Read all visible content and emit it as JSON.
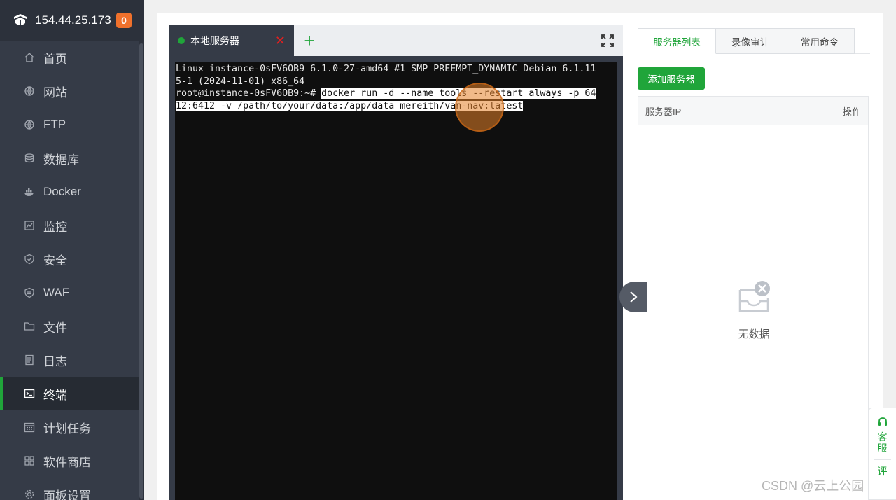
{
  "header": {
    "ip": "154.44.25.173",
    "badge_count": "0"
  },
  "sidebar": {
    "items": [
      {
        "label": "首页",
        "icon": "home-icon"
      },
      {
        "label": "网站",
        "icon": "globe-icon"
      },
      {
        "label": "FTP",
        "icon": "globe-icon"
      },
      {
        "label": "数据库",
        "icon": "database-icon"
      },
      {
        "label": "Docker",
        "icon": "docker-icon"
      },
      {
        "label": "监控",
        "icon": "chart-icon"
      },
      {
        "label": "安全",
        "icon": "shield-icon"
      },
      {
        "label": "WAF",
        "icon": "waf-shield-icon"
      },
      {
        "label": "文件",
        "icon": "folder-icon"
      },
      {
        "label": "日志",
        "icon": "log-icon"
      },
      {
        "label": "终端",
        "icon": "terminal-icon",
        "active": true
      },
      {
        "label": "计划任务",
        "icon": "calendar-icon"
      },
      {
        "label": "软件商店",
        "icon": "grid-icon"
      },
      {
        "label": "面板设置",
        "icon": "gear-icon"
      }
    ]
  },
  "terminal": {
    "tab_label": "本地服务器",
    "close_glyph": "✕",
    "add_glyph": "+",
    "lines": {
      "l1": "Linux instance-0sFV6OB9 6.1.0-27-amd64 #1 SMP PREEMPT_DYNAMIC Debian 6.1.11",
      "l2": "5-1 (2024-11-01) x86_64",
      "l3_prompt": "root@instance-0sFV6OB9:~# ",
      "l3_cmd": "docker run -d --name tools --restart always -p 64",
      "l4_cmd": "12:6412 -v /path/to/your/data:/app/data mereith/van-nav:latest"
    }
  },
  "right_panel": {
    "tabs": [
      "服务器列表",
      "录像审计",
      "常用命令"
    ],
    "active_tab": 0,
    "add_button": "添加服务器",
    "columns": {
      "ip": "服务器IP",
      "action": "操作"
    },
    "empty_text": "无数据"
  },
  "float_help": {
    "service": "客服",
    "review": "评"
  },
  "watermark": "CSDN @云上公园",
  "colors": {
    "accent": "#20a53a",
    "sidebar": "#353b47",
    "badge": "#f0712c",
    "close": "#e02020"
  }
}
